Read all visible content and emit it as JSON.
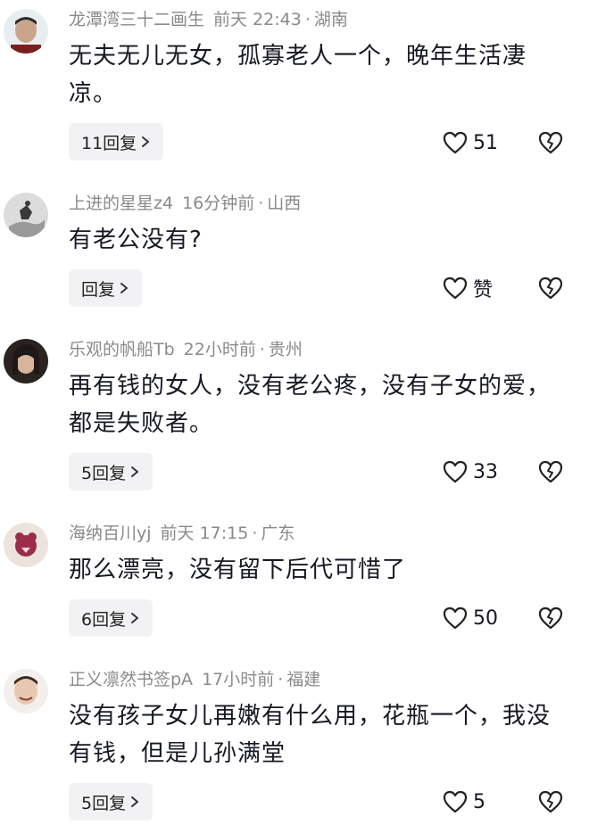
{
  "comments": [
    {
      "username": "龙潭湾三十二画生",
      "time": "前天 22:43",
      "location": "湖南",
      "text": "无夫无儿无女，孤寡老人一个，晚年生活凄凉。",
      "reply_label": "11回复",
      "like_label": "51",
      "avatar_color": "#c9a58b"
    },
    {
      "username": "上进的星星z4",
      "time": "16分钟前",
      "location": "山西",
      "text": "有老公没有?",
      "reply_label": "回复",
      "like_label": "赞",
      "avatar_color": "#d9d9d9"
    },
    {
      "username": "乐观的帆船Tb",
      "time": "22小时前",
      "location": "贵州",
      "text": "再有钱的女人，没有老公疼，没有子女的爱，都是失败者。",
      "reply_label": "5回复",
      "like_label": "33",
      "avatar_color": "#3b2f2a"
    },
    {
      "username": "海纳百川yj",
      "time": "前天 17:15",
      "location": "广东",
      "text": "那么漂亮，没有留下后代可惜了",
      "reply_label": "6回复",
      "like_label": "50",
      "avatar_color": "#e8ddd6"
    },
    {
      "username": "正义凛然书签pA",
      "time": "17小时前",
      "location": "福建",
      "text": "没有孩子女儿再嫩有什么用，花瓶一个，我没有钱，但是儿孙满堂",
      "reply_label": "5回复",
      "like_label": "5",
      "avatar_color": "#e9d2c3"
    }
  ],
  "separator": "·",
  "icons": {
    "like": "heart-outline-icon",
    "dislike": "broken-heart-icon",
    "reply_arrow": "chevron-right-icon"
  }
}
